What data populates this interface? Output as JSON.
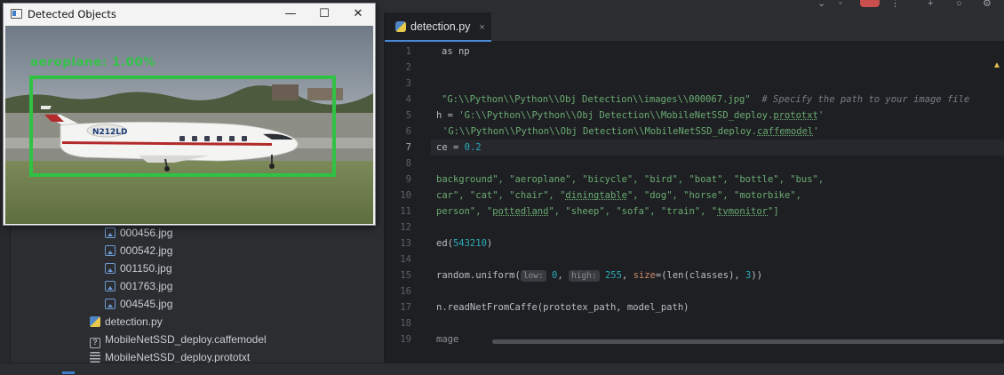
{
  "detection_window": {
    "title": "Detected Objects",
    "label": "aeroplane: 1.00%",
    "tail_number": "N212LD",
    "buttons": {
      "minimize": "—",
      "maximize": "☐",
      "close": "✕"
    },
    "box_color": "#2fc243"
  },
  "project_tree": {
    "items": [
      {
        "icon": "image-file-icon",
        "label": "000456.jpg"
      },
      {
        "icon": "image-file-icon",
        "label": "000542.jpg"
      },
      {
        "icon": "image-file-icon",
        "label": "001150.jpg"
      },
      {
        "icon": "image-file-icon",
        "label": "001763.jpg"
      },
      {
        "icon": "image-file-icon",
        "label": "004545.jpg"
      },
      {
        "icon": "python-file-icon",
        "label": "detection.py"
      },
      {
        "icon": "unknown-file-icon",
        "label": "MobileNetSSD_deploy.caffemodel"
      },
      {
        "icon": "text-file-icon",
        "label": "MobileNetSSD_deploy.prototxt"
      }
    ]
  },
  "editor": {
    "tab": {
      "label": "detection.py",
      "close": "×"
    },
    "current_line": "7",
    "line_numbers": [
      "1",
      "2",
      "3",
      "4",
      "5",
      "6",
      "7",
      "8",
      "9",
      "10",
      "11",
      "12",
      "13",
      "14",
      "15",
      "16",
      "17",
      "18",
      "19"
    ],
    "code": {
      "l1": "as np",
      "l4_str": "\"G:\\\\Python\\\\Python\\\\Obj Detection\\\\images\\\\000067.jpg\"",
      "l4_comment": "# Specify the path to your image file",
      "l5_pre": "h = ",
      "l5_str": "'G:\\\\Python\\\\Python\\\\Obj Detection\\\\MobileNetSSD_deploy.",
      "l5_u": "prototxt",
      "l5_end": "'",
      "l6_str": "'G:\\\\Python\\\\Python\\\\Obj Detection\\\\MobileNetSSD_deploy.",
      "l6_u": "caffemodel",
      "l6_end": "'",
      "l7_pre": "ce = ",
      "l7_num": "0.2",
      "l9": "background\", \"aeroplane\", \"bicycle\", \"bird\", \"boat\", \"bottle\", \"bus\",",
      "l10_a": "car\", \"cat\", \"chair\", \"",
      "l10_u": "diningtable",
      "l10_b": "\", \"dog\", \"horse\", \"motorbike\",",
      "l11_a": "person\", \"",
      "l11_u": "pottedland",
      "l11_b": "\", \"sheep\", \"sofa\", \"train\", \"",
      "l11_u2": "tvmonitor",
      "l11_c": "\"]",
      "l13_pre": "ed(",
      "l13_num": "543210",
      "l13_end": ")",
      "l15_pre": "random.uniform(",
      "l15_hint1": "low:",
      "l15_num1": "0",
      "l15_mid": ", ",
      "l15_hint2": "high:",
      "l15_num2": "255",
      "l15_kw": "size",
      "l15_rest": "=(len(classes), ",
      "l15_num3": "3",
      "l15_end": "))",
      "l17": "n.readNetFromCaffe(prototex_path, model_path)",
      "l19": "mage"
    },
    "warning_icon": "warning-icon"
  },
  "colors": {
    "string": "#6aab73",
    "number": "#2aacb8",
    "keyword": "#cf8e6d",
    "comment": "#7a7e85"
  }
}
